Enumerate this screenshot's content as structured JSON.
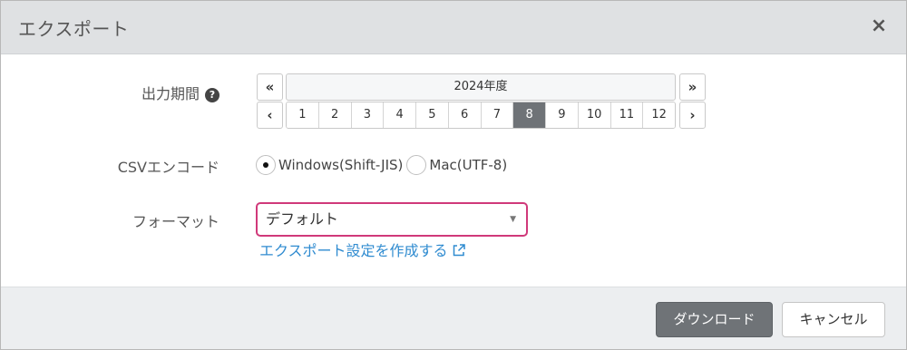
{
  "dialog": {
    "title": "エクスポート",
    "close_label": "×"
  },
  "period": {
    "label": "出力期間",
    "help_icon": "question-circle-icon",
    "prev_year_label": "«",
    "next_year_label": "»",
    "prev_month_label": "‹",
    "next_month_label": "›",
    "year_label": "2024年度",
    "months": [
      "1",
      "2",
      "3",
      "4",
      "5",
      "6",
      "7",
      "8",
      "9",
      "10",
      "11",
      "12"
    ],
    "selected_month": "8"
  },
  "encoding": {
    "label": "CSVエンコード",
    "options": [
      {
        "label": "Windows(Shift-JIS)",
        "checked": true
      },
      {
        "label": "Mac(UTF-8)",
        "checked": false
      }
    ]
  },
  "format": {
    "label": "フォーマット",
    "selected": "デフォルト",
    "arrow_icon": "caret-down-icon",
    "create_link": "エクスポート設定を作成する",
    "link_icon": "external-link-icon"
  },
  "footer": {
    "download_label": "ダウンロード",
    "cancel_label": "キャンセル"
  },
  "colors": {
    "header_bg": "#dfe1e3",
    "selected_month_bg": "#6f7377",
    "select_border": "#d0397a",
    "link": "#2f8bd0",
    "footer_bg": "#eceef0"
  }
}
